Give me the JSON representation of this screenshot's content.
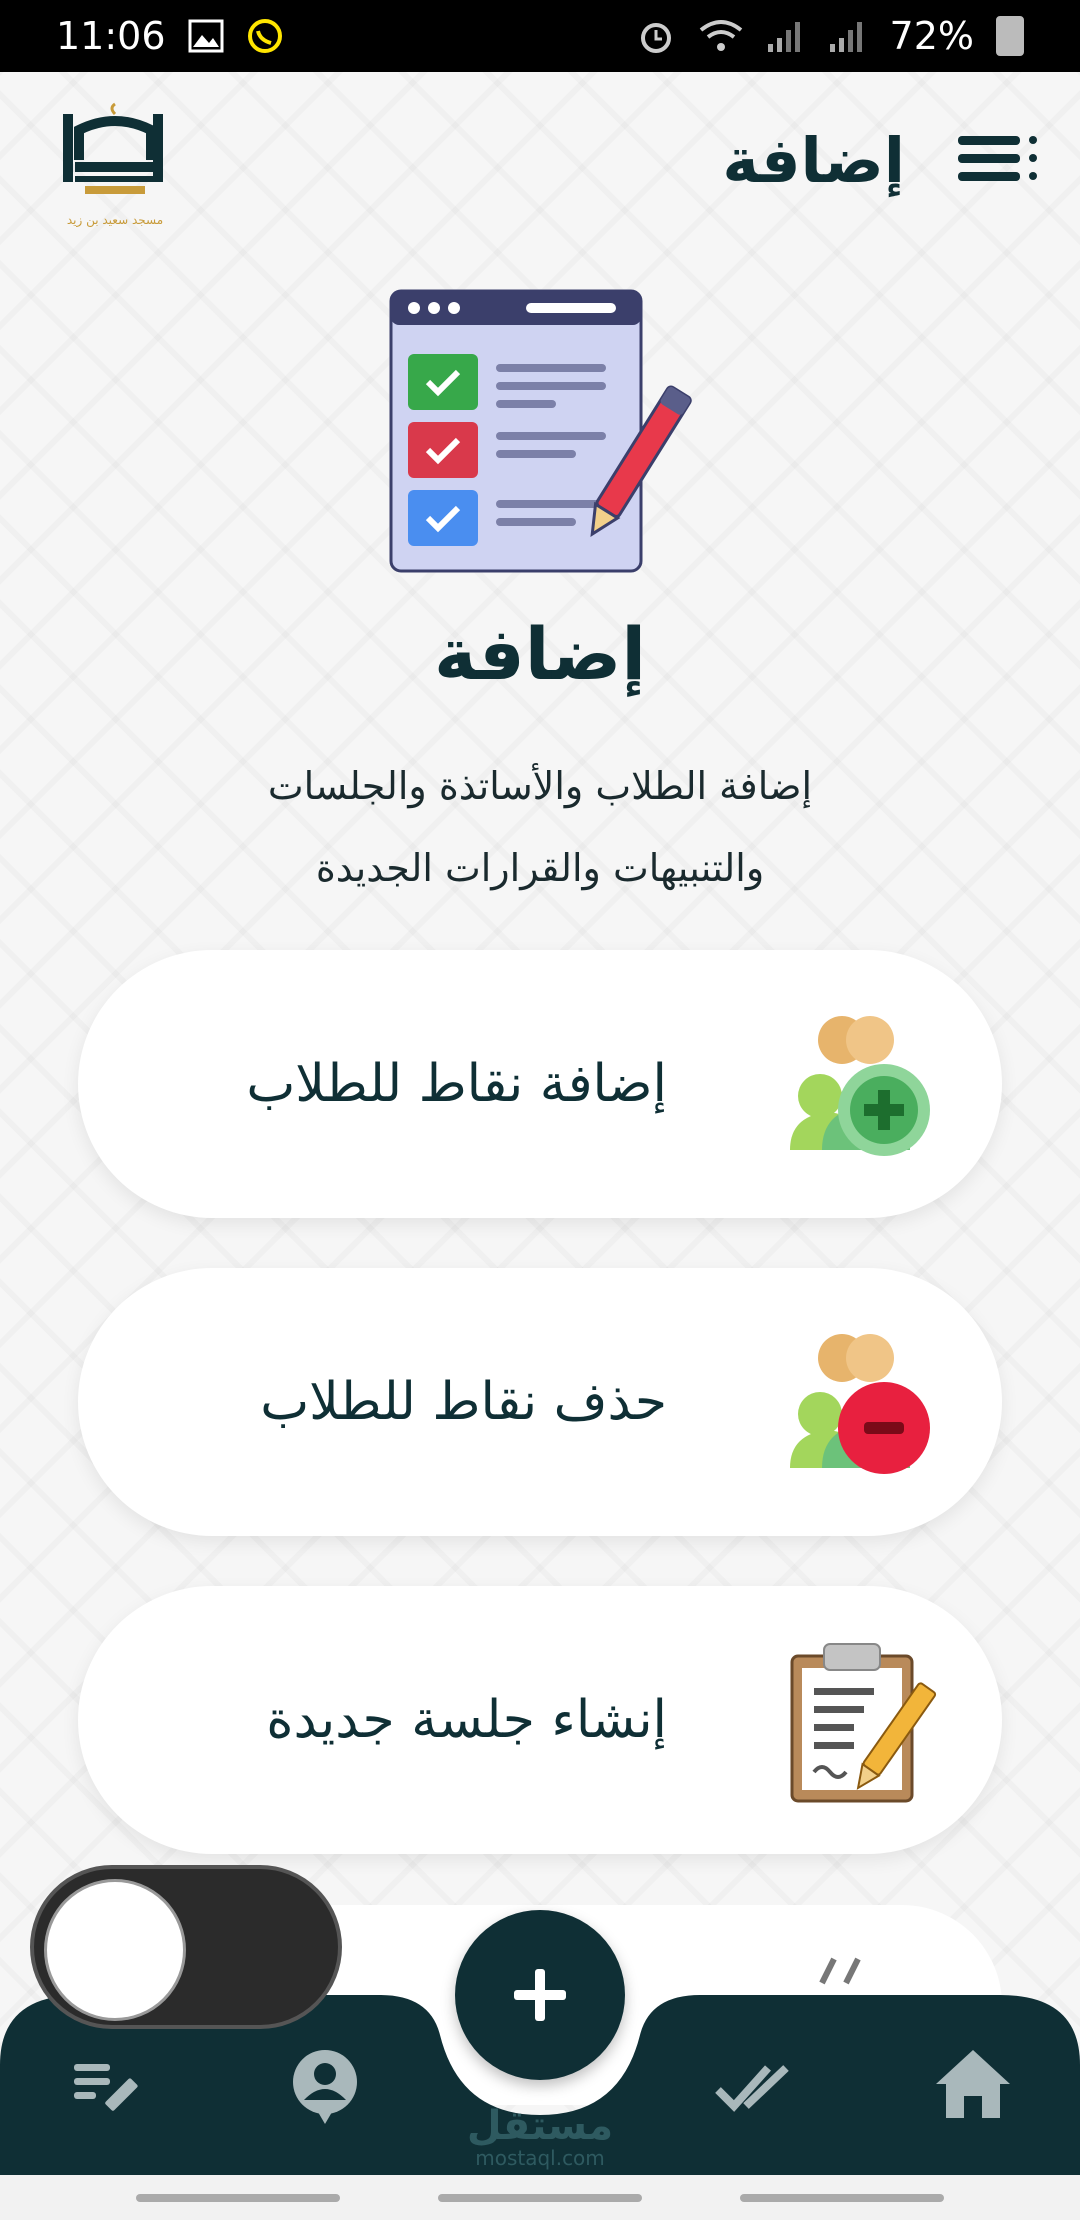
{
  "status_bar": {
    "time": "11:06",
    "battery": "72%"
  },
  "header": {
    "title": "إضافة",
    "logo_text": "مسجد سعيد بن زيد"
  },
  "main": {
    "title": "إضافة",
    "description_line1": "إضافة الطلاب والأساتذة والجلسات",
    "description_line2": "والتنبيهات والقرارات الجديدة"
  },
  "cards": [
    {
      "label": "إضافة نقاط للطلاب",
      "icon": "add-users-icon"
    },
    {
      "label": "حذف نقاط للطلاب",
      "icon": "remove-users-icon"
    },
    {
      "label": "إنشاء جلسة جديدة",
      "icon": "clipboard-edit-icon"
    }
  ],
  "bottom_nav": {
    "items": [
      "notes-edit-icon",
      "profile-icon",
      "done-all-icon",
      "home-icon"
    ],
    "fab_icon": "plus-icon"
  },
  "watermark": {
    "text": "مستقل",
    "sub": "mostaql.com"
  },
  "colors": {
    "primary": "#0f2f35",
    "card_bg": "#ffffff",
    "background": "#f6f6f6"
  }
}
